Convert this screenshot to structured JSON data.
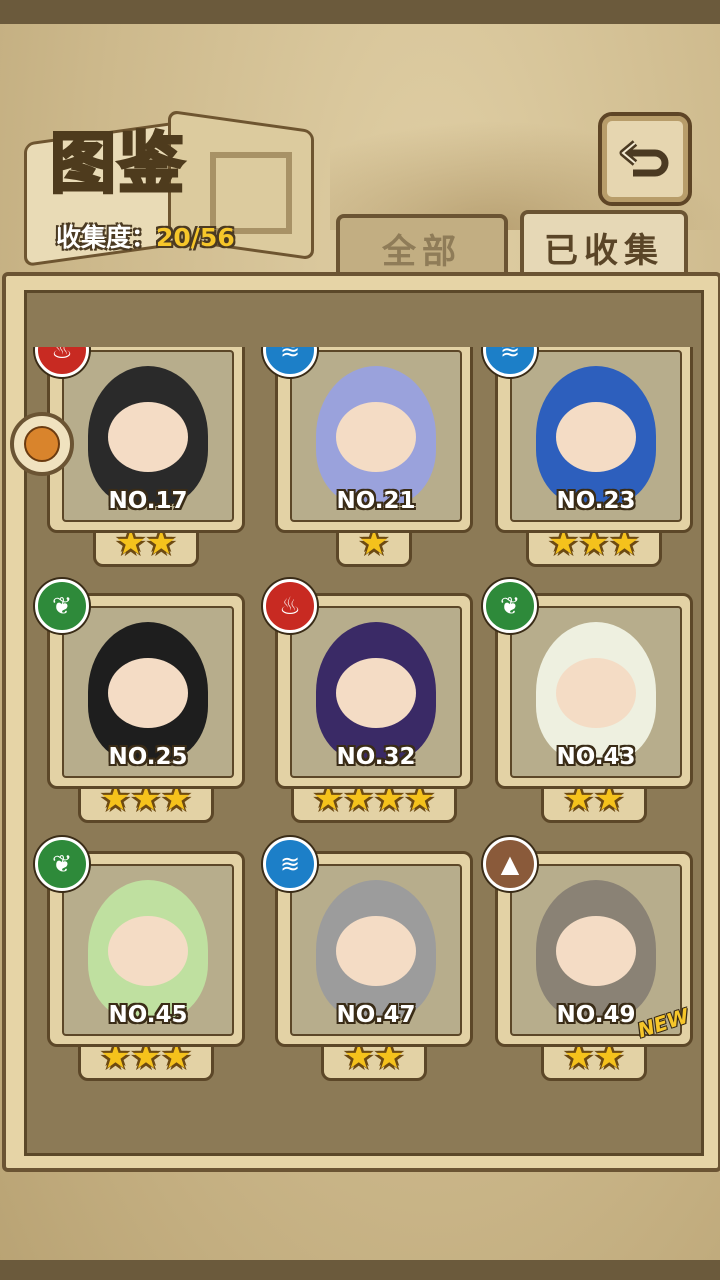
{
  "header": {
    "title": "图鉴",
    "collection_label": "收集度：",
    "collection_value": "20/56"
  },
  "tabs": [
    {
      "label": "全部"
    },
    {
      "label": "已收集"
    }
  ],
  "cards": [
    {
      "no": "NO.17",
      "stars": "★★",
      "element": "fire",
      "color": "#2a2a2a"
    },
    {
      "no": "NO.21",
      "stars": "★",
      "element": "water",
      "color": "#9aa2dc"
    },
    {
      "no": "NO.23",
      "stars": "★★★",
      "element": "water",
      "color": "#2d5fbd"
    },
    {
      "no": "NO.25",
      "stars": "★★★",
      "element": "leaf",
      "color": "#1e1e1e"
    },
    {
      "no": "NO.32",
      "stars": "★★★★",
      "element": "fire",
      "color": "#3a2a66"
    },
    {
      "no": "NO.43",
      "stars": "★★",
      "element": "leaf",
      "color": "#eef0e0"
    },
    {
      "no": "NO.45",
      "stars": "★★★",
      "element": "leaf",
      "color": "#bfe0a0"
    },
    {
      "no": "NO.47",
      "stars": "★★",
      "element": "water",
      "color": "#9c9c9c"
    },
    {
      "no": "NO.49",
      "stars": "★★",
      "element": "earth",
      "color": "#8a8275",
      "badge": "NEW"
    }
  ]
}
